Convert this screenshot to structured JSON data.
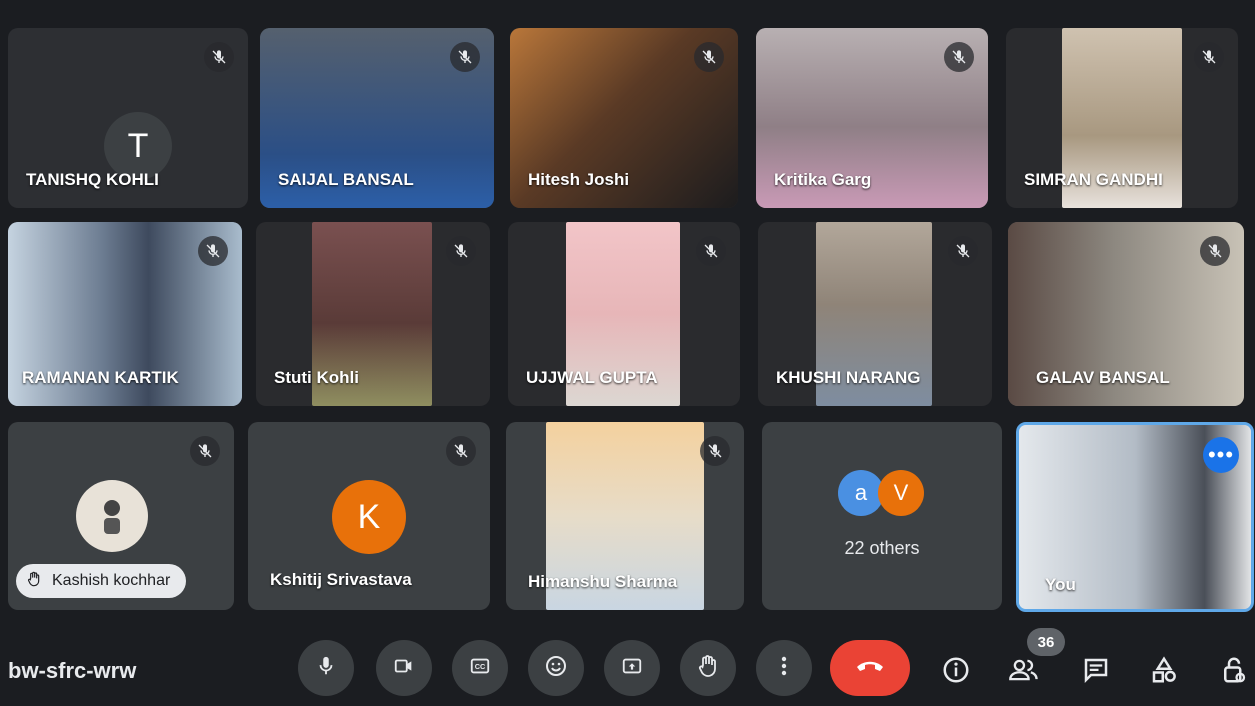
{
  "participants": [
    {
      "name": "TANISHQ KOHLI",
      "initial": "T"
    },
    {
      "name": "SAIJAL BANSAL"
    },
    {
      "name": "Hitesh Joshi"
    },
    {
      "name": "Kritika Garg"
    },
    {
      "name": "SIMRAN GANDHI"
    },
    {
      "name": "RAMANAN KARTIK"
    },
    {
      "name": "Stuti Kohli"
    },
    {
      "name": "UJJWAL GUPTA"
    },
    {
      "name": "KHUSHI NARANG"
    },
    {
      "name": "GALAV BANSAL"
    },
    {
      "name": "Kashish kochhar"
    },
    {
      "name": "Kshitij Srivastava",
      "initial": "K"
    },
    {
      "name": "Himanshu Sharma"
    }
  ],
  "others": {
    "label": "22 others",
    "avatar_a": "a",
    "avatar_v": "V"
  },
  "self": {
    "name": "You",
    "more_label": "•••"
  },
  "meeting": {
    "code": "bw-sfrc-wrw"
  },
  "people_count": "36",
  "colors": {
    "accent": "#1a73e8",
    "end_call": "#ea4335",
    "kshitij": "#e8710a"
  }
}
